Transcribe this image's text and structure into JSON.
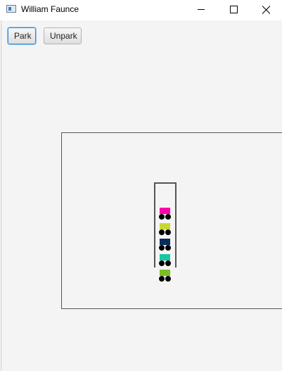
{
  "window": {
    "title": "William Faunce",
    "icons": {
      "app": "app-window-icon",
      "minimize": "minimize-icon",
      "maximize": "maximize-icon",
      "close": "close-icon"
    }
  },
  "toolbar": {
    "park_label": "Park",
    "unpark_label": "Unpark"
  },
  "parking": {
    "cars": [
      {
        "color": "#ff00aa"
      },
      {
        "color": "#c8d832"
      },
      {
        "color": "#0b2d5a"
      },
      {
        "color": "#14c8a0"
      },
      {
        "color": "#7cbc24"
      }
    ]
  }
}
